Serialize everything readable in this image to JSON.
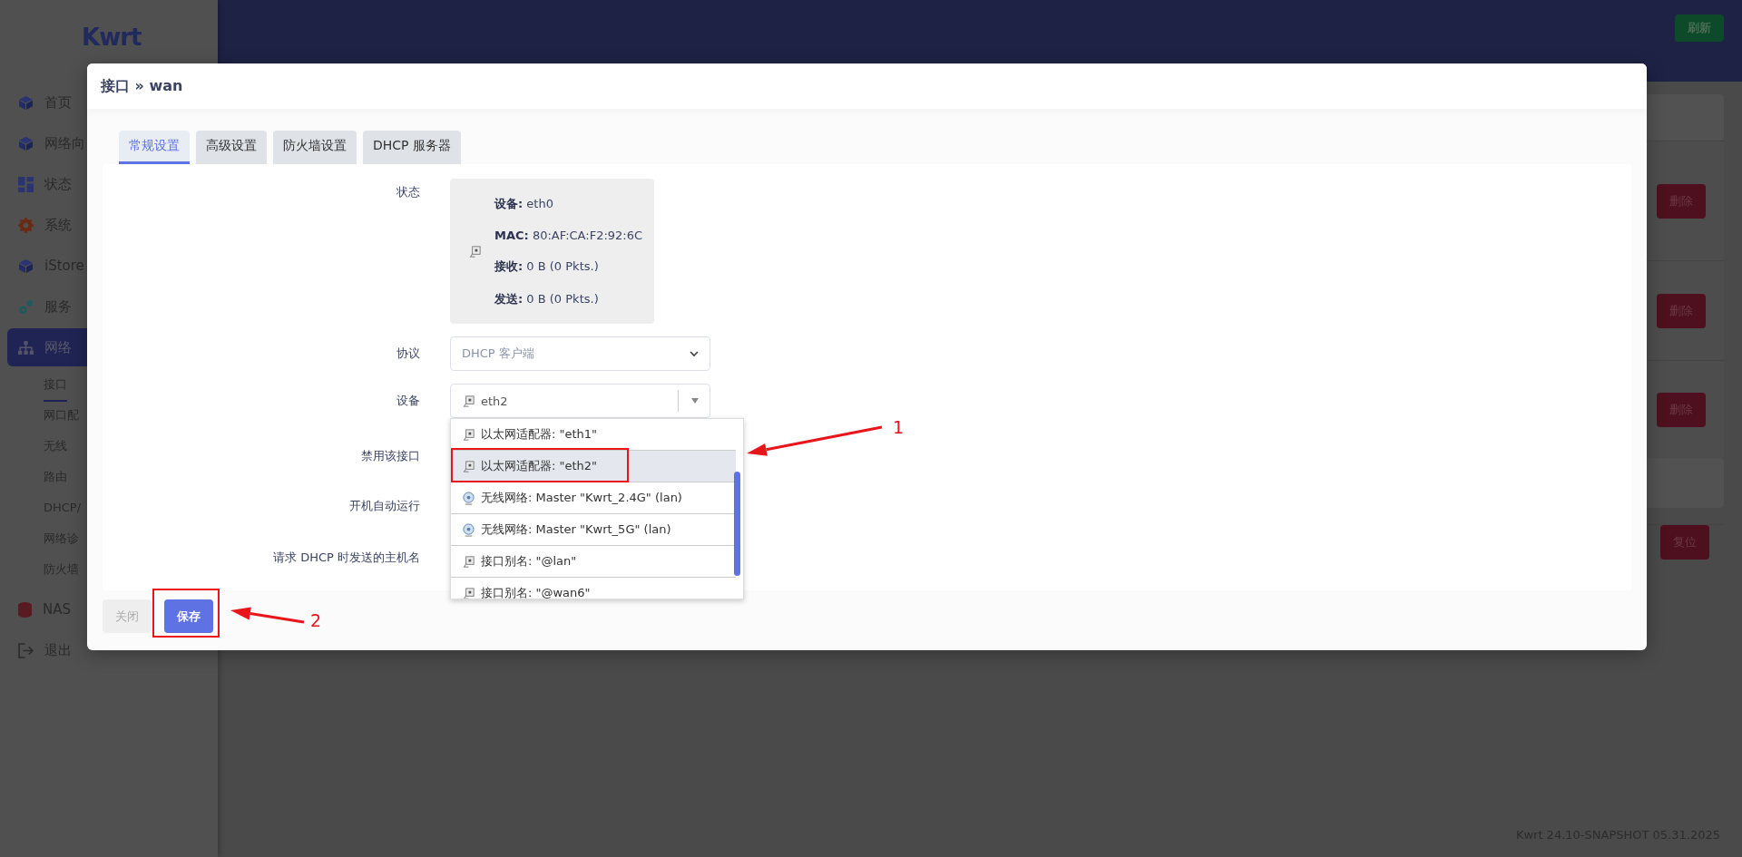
{
  "sidebar": {
    "logo": "Kwrt",
    "items": [
      {
        "label": "首页",
        "selected": false
      },
      {
        "label": "网络向",
        "selected": false
      },
      {
        "label": "状态",
        "selected": false
      },
      {
        "label": "系统",
        "selected": false
      },
      {
        "label": "iStore",
        "selected": false
      },
      {
        "label": "服务",
        "selected": false
      },
      {
        "label": "网络",
        "selected": true,
        "children": [
          {
            "label": "接口",
            "selected": true
          },
          {
            "label": "网口配",
            "selected": false
          },
          {
            "label": "无线",
            "selected": false
          },
          {
            "label": "路由",
            "selected": false
          },
          {
            "label": "DHCP/",
            "selected": false
          },
          {
            "label": "网络诊",
            "selected": false
          },
          {
            "label": "防火墙",
            "selected": false
          }
        ]
      },
      {
        "label": "NAS",
        "selected": false
      },
      {
        "label": "退出",
        "selected": false
      }
    ]
  },
  "header": {
    "refresh_button": "刷新"
  },
  "background_rows": [
    {
      "button": "删除"
    },
    {
      "button": "删除"
    },
    {
      "button": "删除"
    },
    {
      "button": "复位"
    }
  ],
  "footer": "Kwrt 24.10-SNAPSHOT 05.31.2025",
  "modal": {
    "title": "接口 » wan",
    "tabs": [
      {
        "label": "常规设置",
        "selected": true
      },
      {
        "label": "高级设置",
        "selected": false
      },
      {
        "label": "防火墙设置",
        "selected": false
      },
      {
        "label": "DHCP 服务器",
        "selected": false
      }
    ],
    "status": {
      "label": "状态",
      "lines": [
        "**设备:** eth0",
        "**MAC:** 80:AF:CA:F2:92:6C",
        "**接收:** 0 B (0 Pkts.)",
        "**发送:** 0 B (0 Pkts.)"
      ]
    },
    "protocol": {
      "label": "协议",
      "value": "DHCP 客户端"
    },
    "device": {
      "label": "设备",
      "value": "eth2",
      "expanded": true,
      "options": [
        {
          "label": "以太网适配器: \"eth1\"",
          "kind": "ethernet",
          "selected": false
        },
        {
          "label": "以太网适配器: \"eth2\"",
          "kind": "ethernet",
          "selected": true
        },
        {
          "label": "无线网络: Master \"Kwrt_2.4G\" (lan)",
          "kind": "wireless",
          "selected": false
        },
        {
          "label": "无线网络: Master \"Kwrt_5G\" (lan)",
          "kind": "wireless",
          "selected": false
        },
        {
          "label": "接口别名: \"@lan\"",
          "kind": "alias",
          "selected": false
        },
        {
          "label": "接口别名: \"@wan6\"",
          "kind": "alias",
          "selected": false
        }
      ]
    },
    "other_labels": [
      "禁用该接口",
      "开机自动运行",
      "请求 DHCP 时发送的主机名"
    ],
    "buttons": [
      {
        "label": "关闭",
        "kind": "dismiss"
      },
      {
        "label": "保存",
        "kind": "primary"
      }
    ]
  },
  "annotations": [
    {
      "label": "1"
    },
    {
      "label": "2"
    }
  ]
}
